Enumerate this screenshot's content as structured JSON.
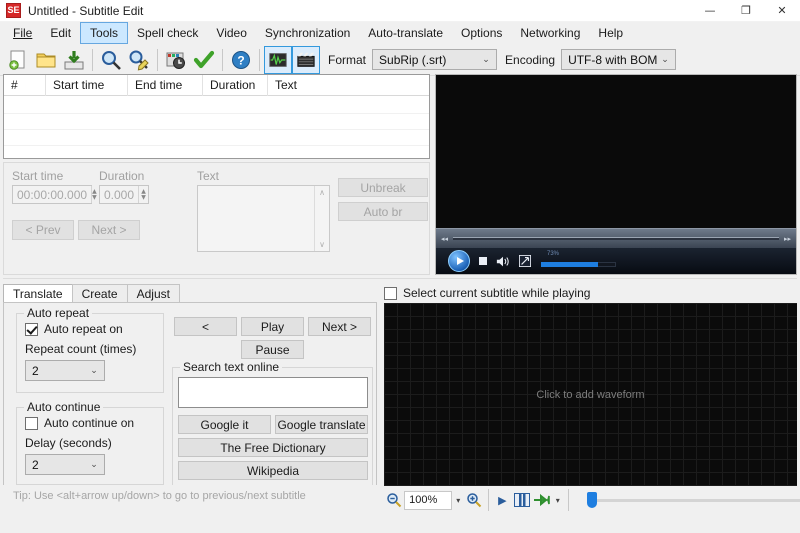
{
  "window": {
    "title": "Untitled - Subtitle Edit",
    "app_icon": "SE",
    "minimize": "—",
    "maximize": "❐",
    "close": "✕"
  },
  "menu": {
    "items": [
      {
        "label": "File",
        "hot": false
      },
      {
        "label": "Edit",
        "hot": false
      },
      {
        "label": "Tools",
        "hot": true
      },
      {
        "label": "Spell check",
        "hot": false
      },
      {
        "label": "Video",
        "hot": false
      },
      {
        "label": "Synchronization",
        "hot": false
      },
      {
        "label": "Auto-translate",
        "hot": false
      },
      {
        "label": "Options",
        "hot": false
      },
      {
        "label": "Networking",
        "hot": false
      },
      {
        "label": "Help",
        "hot": false
      }
    ]
  },
  "toolbar": {
    "buttons": [
      {
        "name": "new-icon",
        "toggled": false
      },
      {
        "name": "open-folder-icon",
        "toggled": false
      },
      {
        "name": "save-icon",
        "toggled": false
      },
      {
        "name": "find-icon",
        "toggled": false
      },
      {
        "name": "replace-icon",
        "toggled": false
      },
      {
        "name": "sync-time-icon",
        "toggled": false
      },
      {
        "name": "fix-common-errors-icon",
        "toggled": false
      },
      {
        "name": "help-icon",
        "toggled": false
      },
      {
        "name": "toggle-waveform-icon",
        "toggled": true
      },
      {
        "name": "toggle-video-icon",
        "toggled": true
      }
    ],
    "format_label": "Format",
    "format_value": "SubRip (.srt)",
    "encoding_label": "Encoding",
    "encoding_value": "UTF-8 with BOM",
    "dropdown_arrow": "⌄"
  },
  "subtitle_list": {
    "columns": [
      "#",
      "Start time",
      "End time",
      "Duration",
      "Text"
    ],
    "rows": []
  },
  "edit_panel": {
    "start_time_label": "Start time",
    "start_time_value": "00:00:00.000",
    "duration_label": "Duration",
    "duration_value": "0.000",
    "text_label": "Text",
    "text_value": "",
    "prev_button": "< Prev",
    "next_button": "Next >",
    "unbreak_button": "Unbreak",
    "autobr_button": "Auto br",
    "spin_up": "▲",
    "spin_down": "▼",
    "scroll_up": "∧",
    "scroll_down": "∨"
  },
  "video": {
    "play": "play-triangle",
    "stop": "stop-square",
    "volume_icon": "🔊",
    "fullscreen_icon": "⤡",
    "volume_percent": "73%",
    "seek_back": "◂◂",
    "seek_forward": "▸▸"
  },
  "tabs": [
    {
      "label": "Translate",
      "active": true
    },
    {
      "label": "Create",
      "active": false
    },
    {
      "label": "Adjust",
      "active": false
    }
  ],
  "translate_tab": {
    "auto_repeat": {
      "group_title": "Auto repeat",
      "checkbox_label": "Auto repeat on",
      "checked": true,
      "count_label": "Repeat count (times)",
      "count_value": "2"
    },
    "auto_continue": {
      "group_title": "Auto continue",
      "checkbox_label": "Auto continue on",
      "checked": false,
      "delay_label": "Delay (seconds)",
      "delay_value": "2"
    },
    "playback": {
      "prev_button": "<",
      "play_button": "Play",
      "next_button": "Next >",
      "pause_button": "Pause"
    },
    "search_online": {
      "group_title": "Search text online",
      "input_value": "",
      "google_it": "Google it",
      "google_translate": "Google translate",
      "free_dictionary": "The Free Dictionary",
      "wikipedia": "Wikipedia"
    },
    "tip": "Tip: Use <alt+arrow up/down> to go to previous/next subtitle"
  },
  "waveform": {
    "select_checkbox_label": "Select current subtitle while playing",
    "select_checked": false,
    "placeholder": "Click to add waveform",
    "zoom_value": "100%",
    "zoom_out_icon": "zoom-out-icon",
    "zoom_in_icon": "zoom-in-icon",
    "play_icon": "▶",
    "split_icon": "split-view-icon",
    "forward_icon": "⇉",
    "dropdown_arrow": "▾"
  },
  "colors": {
    "accent": "#1e7ee0",
    "toolbar_toggle": "#dcecfb",
    "menu_hot": "#cce8ff",
    "waveform_bg": "#0b0b0b",
    "video_bg": "#0a0a0a"
  }
}
